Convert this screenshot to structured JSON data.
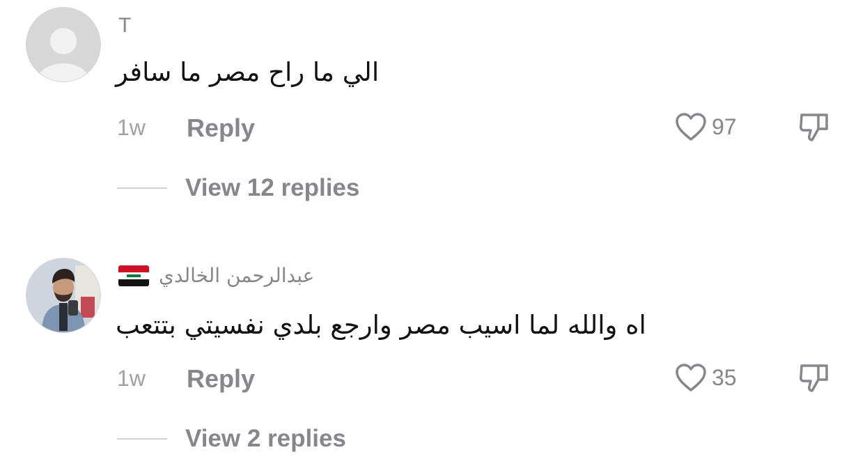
{
  "comments": [
    {
      "username": "T",
      "text": "الي ما راح مصر ما سافر",
      "time": "1w",
      "reply_label": "Reply",
      "likes": "97",
      "view_replies": "View 12 replies"
    },
    {
      "username": "عبدالرحمن الخالدي",
      "flag": "iraq-flag-icon",
      "text": "اه والله لما اسيب مصر وارجع بلدي نفسيتي بتتعب",
      "time": "1w",
      "reply_label": "Reply",
      "likes": "35",
      "view_replies": "View 2 replies"
    }
  ],
  "colors": {
    "muted": "#86868b",
    "text": "#111111",
    "background": "#ffffff"
  }
}
